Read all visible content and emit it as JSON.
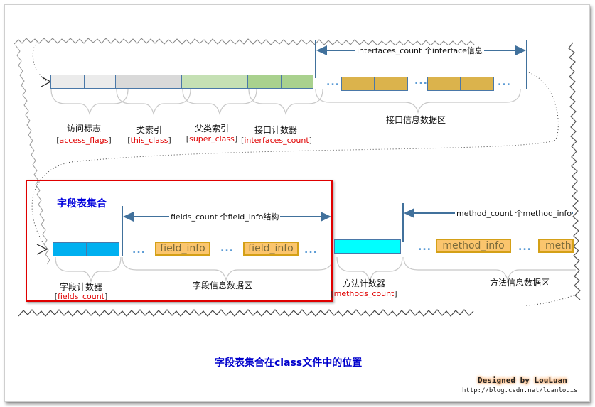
{
  "colors": {
    "access_flags": "#ebebeb",
    "this_class": "#d9d9d9",
    "super_class": "#c5e0b4",
    "interfaces_count": "#a9d18e",
    "interface_item": "#dbb34c",
    "fields_count": "#00b0f0",
    "methods_count": "#00ffff",
    "info_box": "#fbc56d",
    "highlight_border": "#e00000",
    "arrow": "#41719c",
    "label_red": "#e00000",
    "caption_blue": "#0000cc"
  },
  "row1": {
    "segments": [
      {
        "cn": "访问标志",
        "en": "access_flags"
      },
      {
        "cn": "类索引",
        "en": "this_class"
      },
      {
        "cn": "父类索引",
        "en": "super_class"
      },
      {
        "cn": "接口计数器",
        "en": "interfaces_count"
      }
    ],
    "interfaces_arrow_label": "interfaces_count 个interface信息",
    "interfaces_region_label": "接口信息数据区",
    "ellipsis": "..."
  },
  "row2": {
    "section_title": "字段表集合",
    "fields_counter": {
      "cn": "字段计数器",
      "en": "fields_count"
    },
    "fields_arrow_label": "fields_count 个field_info结构",
    "field_items": [
      "field_info",
      "field_info"
    ],
    "fields_region_label": "字段信息数据区",
    "methods_counter": {
      "cn": "方法计数器",
      "en": "methods_count"
    },
    "methods_arrow_label": "method_count 个method_info结",
    "method_items": [
      "method_info",
      "meth"
    ],
    "methods_region_label": "方法信息数据区",
    "ellipsis": "..."
  },
  "caption": "字段表集合在class文件中的位置",
  "signature": {
    "designer": "Designed by LouLuan",
    "url": "http://blog.csdn.net/luanlouis"
  }
}
